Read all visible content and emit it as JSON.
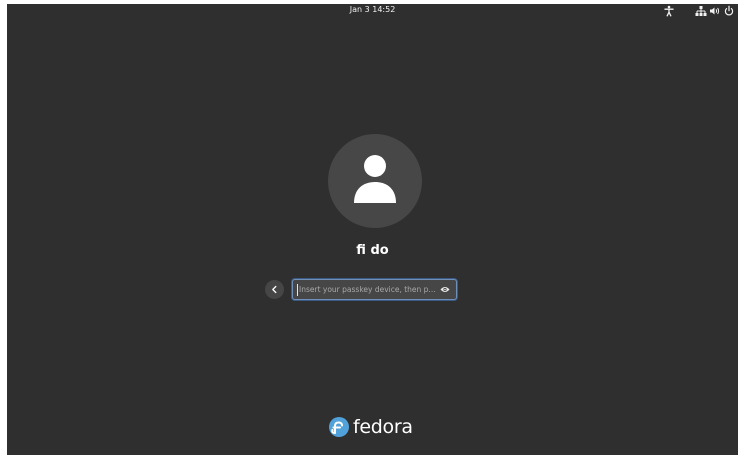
{
  "topbar": {
    "datetime": "Jan 3  14:52",
    "icons": [
      "accessibility-icon",
      "network-wired-icon",
      "volume-icon",
      "power-icon"
    ]
  },
  "login": {
    "avatar_icon": "user-avatar-icon",
    "username": "fi do",
    "back_icon": "chevron-left-icon",
    "entry_placeholder": "Insert your passkey device, then p...",
    "reveal_icon": "eye-icon"
  },
  "branding": {
    "logo_icon": "fedora-badge-icon",
    "wordmark": "fedora"
  },
  "colors": {
    "background": "#2f2f2f",
    "avatar_bg": "#474747",
    "entry_bg": "#464646",
    "entry_focus": "#6f8fb8",
    "fedora_blue": "#51a2da"
  }
}
